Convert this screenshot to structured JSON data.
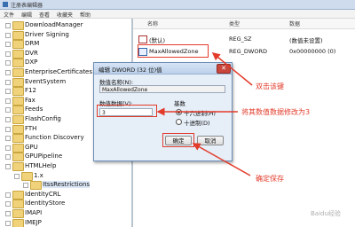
{
  "window": {
    "title": "注册表编辑器"
  },
  "menu": [
    "文件",
    "编辑",
    "查看",
    "收藏夹",
    "帮助"
  ],
  "tree": {
    "items": [
      {
        "label": "DownloadManager",
        "indent": 0
      },
      {
        "label": "Driver Signing",
        "indent": 0
      },
      {
        "label": "DRM",
        "indent": 0
      },
      {
        "label": "DVR",
        "indent": 0
      },
      {
        "label": "DXP",
        "indent": 0
      },
      {
        "label": "EnterpriseCertificates",
        "indent": 0
      },
      {
        "label": "EventSystem",
        "indent": 0
      },
      {
        "label": "F12",
        "indent": 0
      },
      {
        "label": "Fax",
        "indent": 0
      },
      {
        "label": "Feeds",
        "indent": 0
      },
      {
        "label": "FlashConfig",
        "indent": 0
      },
      {
        "label": "FTH",
        "indent": 0
      },
      {
        "label": "Function Discovery",
        "indent": 0
      },
      {
        "label": "GPU",
        "indent": 0
      },
      {
        "label": "GPUPipeline",
        "indent": 0
      },
      {
        "label": "HTMLHelp",
        "indent": 0
      },
      {
        "label": "1.x",
        "indent": 1
      },
      {
        "label": "ItssRestrictions",
        "indent": 2
      },
      {
        "label": "IdentityCRL",
        "indent": 0
      },
      {
        "label": "IdentityStore",
        "indent": 0
      },
      {
        "label": "IMAPI",
        "indent": 0
      },
      {
        "label": "IMEJP",
        "indent": 0
      }
    ]
  },
  "values": {
    "headers": [
      "名称",
      "类型",
      "数据"
    ],
    "rows": [
      {
        "name": "(默认)",
        "type": "REG_SZ",
        "data": "(数值未设置)",
        "kind": "str"
      },
      {
        "name": "MaxAllowedZone",
        "type": "REG_DWORD",
        "data": "0x00000000 (0)",
        "kind": "bin"
      }
    ]
  },
  "dialog": {
    "title": "编辑 DWORD (32 位)值",
    "close": "✕",
    "name_label": "数值名称(N):",
    "name_value": "MaxAllowedZone",
    "data_label": "数值数据(V):",
    "data_value": "3",
    "base_label": "基数",
    "hex_label": "十六进制(H)",
    "dec_label": "十进制(D)",
    "ok": "确定",
    "cancel": "取消"
  },
  "annotations": {
    "double_click": "双击该键",
    "change_value": "将其数值数据修改为3",
    "confirm_save": "确定保存"
  },
  "watermark": "Baidu经验",
  "colors": {
    "annotation": "#e23b2a",
    "folder": "#f0d27a",
    "dialog_bg": "#e6eef8"
  }
}
